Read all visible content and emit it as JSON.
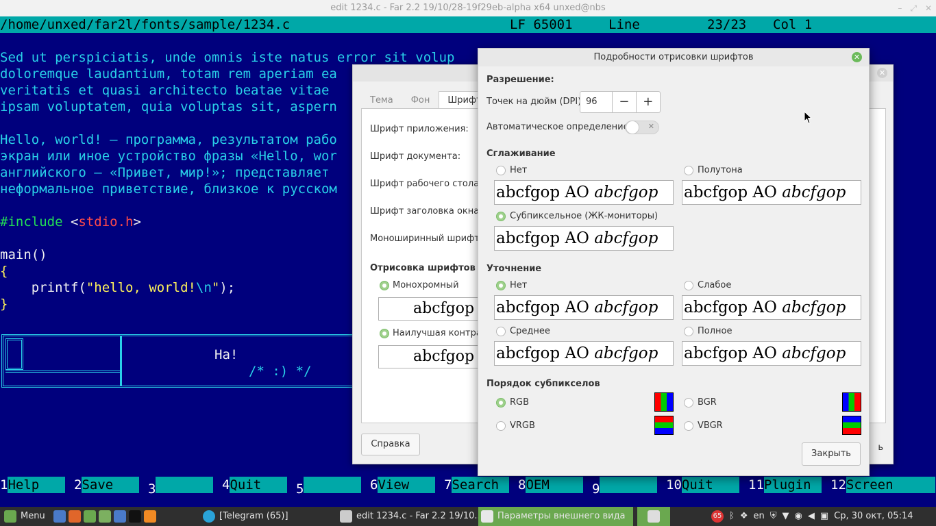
{
  "window": {
    "title": "edit 1234.c - Far 2.2 19/10/28-19f29eb-alpha x64 unxed@nbs",
    "btn_min": "–",
    "btn_max": "⤢",
    "btn_close": "✕"
  },
  "far": {
    "status": {
      "path": "/home/unxed/far2l/fonts/sample/1234.c",
      "eol": "LF 65001",
      "line_label": "Line",
      "line_value": "23/23",
      "col": "Col 1"
    },
    "lines": [
      "Sed ut perspiciatis, unde omnis iste natus error sit volup",
      "doloremque laudantium, totam rem aperiam ea",
      "veritatis et quasi architecto beatae vitae",
      "ipsam voluptatem, quia voluptas sit, aspern",
      "Hello, world! — программа, результатом рабо",
      "экран или иное устройство фразы «Hello, wor",
      "английского — «Привет, мир!»; представляет",
      "неформальное приветствие, близкое к русском"
    ],
    "code": {
      "include": "#include ",
      "header_open": "<",
      "header": "stdio.h",
      "header_close": ">",
      "main": "main()",
      "brace_open": "{",
      "printf_pre": "    printf(",
      "str": "\"hello, world!",
      "esc": "\\n",
      "str_end": "\"",
      "printf_post": ");",
      "brace_close": "}"
    },
    "box": {
      "title": "На!",
      "comment": "/* :) */"
    },
    "fkeys": [
      {
        "num": "1",
        "label": "Help"
      },
      {
        "num": "2",
        "label": "Save"
      },
      {
        "num": "3",
        "label": ""
      },
      {
        "num": "4",
        "label": "Quit"
      },
      {
        "num": "5",
        "label": ""
      },
      {
        "num": "6",
        "label": "View"
      },
      {
        "num": "7",
        "label": "Search"
      },
      {
        "num": "8",
        "label": "OEM"
      },
      {
        "num": "9",
        "label": ""
      },
      {
        "num": "10",
        "label": "Quit"
      },
      {
        "num": "11",
        "label": "Plugin"
      },
      {
        "num": "12",
        "label": "Screen"
      }
    ]
  },
  "appearance": {
    "tabs": [
      "Тема",
      "Фон",
      "Шрифты"
    ],
    "labels": [
      "Шрифт приложения:",
      "Шрифт документа:",
      "Шрифт рабочего стола:",
      "Шрифт заголовка окна:",
      "Моноширинный шрифт:"
    ],
    "render_header": "Отрисовка шрифтов",
    "radio_mono": "Монохромный",
    "radio_best": "Наилучшая контраст",
    "preview": "abcfgop",
    "help": "Справка",
    "close_partial": "ь"
  },
  "dialog": {
    "title": "Подробности отрисовки шрифтов",
    "resolution_header": "Разрешение:",
    "dpi_label": "Точек на дюйм (DPI):",
    "dpi_value": "96",
    "minus": "−",
    "plus": "+",
    "auto_label": "Автоматическое определение:",
    "smoothing_header": "Сглаживание",
    "smooth_none": "Нет",
    "smooth_gray": "Полутона",
    "smooth_subpixel": "Субпиксельное (ЖК-мониторы)",
    "hinting_header": "Уточнение",
    "hint_none": "Нет",
    "hint_slight": "Слабое",
    "hint_medium": "Среднее",
    "hint_full": "Полное",
    "order_header": "Порядок субпикселов",
    "order_rgb": "RGB",
    "order_bgr": "BGR",
    "order_vrgb": "VRGB",
    "order_vbgr": "VBGR",
    "preview_normal": "abcfgop AO ",
    "preview_italic": "abcfgop",
    "close": "Закрыть"
  },
  "taskbar": {
    "menu": "Menu",
    "telegram": "[Telegram (65)]",
    "far": "edit 1234.c - Far 2.2 19/10...",
    "appearance": "Параметры внешнего вида",
    "badge": "65",
    "lang": "en",
    "clock": "Ср, 30 окт, 05:14"
  }
}
